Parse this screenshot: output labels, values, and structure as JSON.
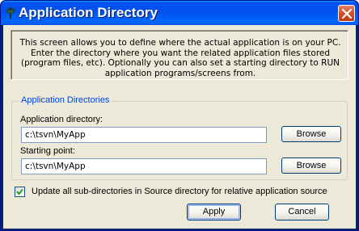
{
  "window": {
    "title": "Application Directory"
  },
  "info": {
    "text": "This screen allows you to define where the actual application is on your PC.  Enter the directory where you want the related application files stored (program files, etc). Optionally you can also set a starting directory to RUN application programs/screens from."
  },
  "group": {
    "legend": "Application Directories",
    "app_dir": {
      "label": "Application directory:",
      "value": "c:\\tsvn\\MyApp",
      "browse_label": "Browse"
    },
    "start_point": {
      "label": "Starting point:",
      "value": "c:\\tsvn\\MyApp",
      "browse_label": "Browse"
    }
  },
  "options": {
    "update_subdirs": {
      "label": "Update all sub-directories in Source directory for relative application source",
      "checked": true
    }
  },
  "buttons": {
    "apply_label": "Apply",
    "cancel_label": "Cancel"
  },
  "icons": {
    "app": "pin-icon",
    "close": "close-icon",
    "check": "check-icon"
  }
}
